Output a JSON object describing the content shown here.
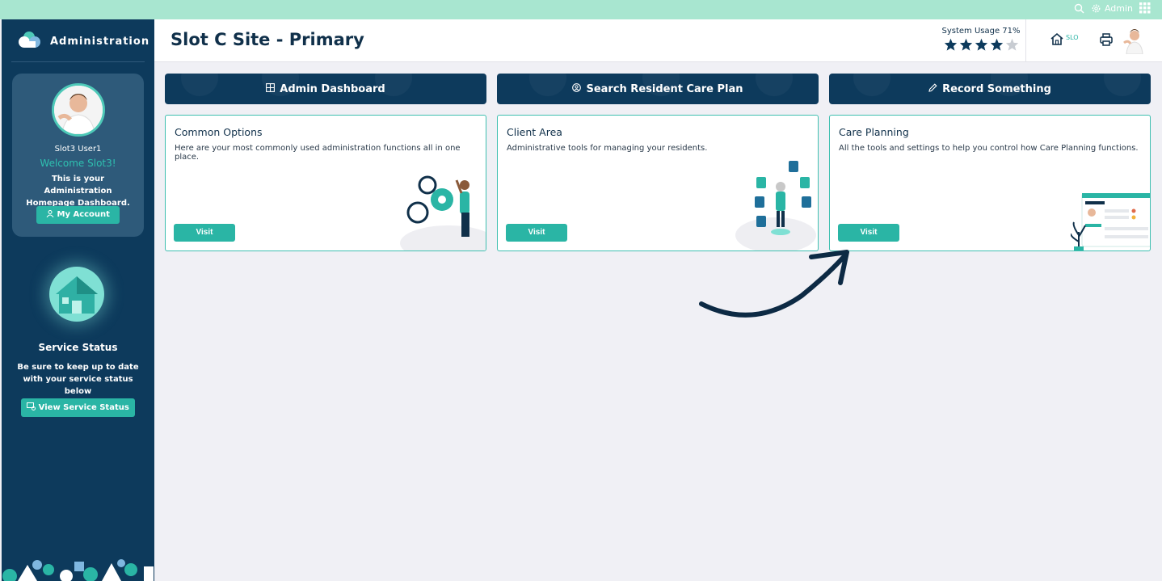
{
  "topbar": {
    "user_label": "Admin"
  },
  "sidebar": {
    "brand": "Administration",
    "profile": {
      "name": "Slot3 User1",
      "welcome": "Welcome Slot3!",
      "description": "This is your Administration Homepage Dashboard.",
      "button_label": "My Account"
    },
    "service": {
      "title": "Service Status",
      "description": "Be sure to keep up to date with your service status below",
      "button_label": "View Service Status"
    }
  },
  "header": {
    "title": "Slot C Site - Primary",
    "usage_label": "System Usage 71%",
    "usage_stars": 4,
    "usage_stars_max": 5,
    "site_code": "SLO"
  },
  "quick_actions": [
    {
      "label": "Admin Dashboard",
      "icon": "grid-icon"
    },
    {
      "label": "Search Resident Care Plan",
      "icon": "search-user-icon"
    },
    {
      "label": "Record Something",
      "icon": "pencil-icon"
    }
  ],
  "cards": [
    {
      "title": "Common Options",
      "description": "Here are your most commonly used administration functions all in one place.",
      "button": "Visit"
    },
    {
      "title": "Client Area",
      "description": "Administrative tools for managing your residents.",
      "button": "Visit"
    },
    {
      "title": "Care Planning",
      "description": "All the tools and settings to help you control how Care Planning functions.",
      "button": "Visit"
    }
  ],
  "colors": {
    "navy": "#0d3a5c",
    "teal": "#2ab5a5",
    "mint": "#a8e6d0",
    "background": "#f0f0f5"
  }
}
